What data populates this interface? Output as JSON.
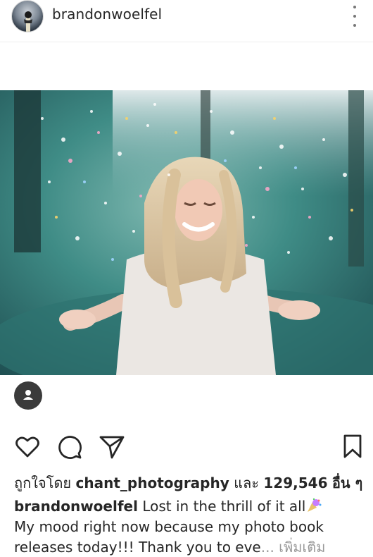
{
  "post": {
    "username": "brandonwoelfel",
    "image_alt": "Woman smiling in falling confetti",
    "likes": {
      "prefix": "ถูกใจโดย",
      "liker": "chant_photography",
      "connector": "และ",
      "count": "129,546",
      "suffix": "อื่น ๆ"
    },
    "caption": {
      "author": "brandonwoelfel",
      "line1": "Lost in the thrill of it all",
      "line2": "My mood right now because my photo book",
      "line3": "releases today!!! Thank you to eve",
      "ellipsis": "...",
      "more_label": "เพิ่มเติม"
    }
  },
  "icons": {
    "more": "more-vertical-icon",
    "tag": "person-tag-icon",
    "like": "heart-icon",
    "comment": "comment-icon",
    "share": "send-icon",
    "save": "bookmark-icon",
    "emoji": "confetti-ball-icon"
  },
  "colors": {
    "text": "#262626",
    "muted": "#999999",
    "photo_tone": "#3a7e78"
  }
}
